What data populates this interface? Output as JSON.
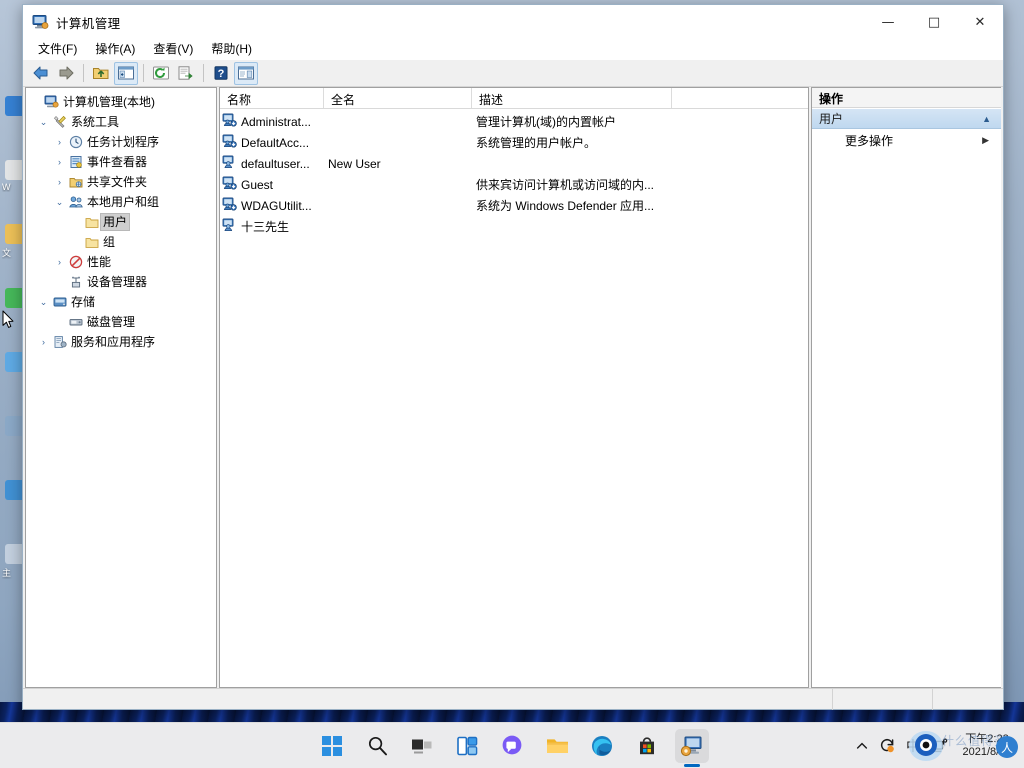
{
  "window": {
    "title": "计算机管理",
    "icon": "computer-management-icon",
    "controls": {
      "minimize": "—",
      "maximize": "□",
      "close": "✕"
    }
  },
  "menubar": [
    {
      "label": "文件(F)",
      "name": "menu-file"
    },
    {
      "label": "操作(A)",
      "name": "menu-action"
    },
    {
      "label": "查看(V)",
      "name": "menu-view"
    },
    {
      "label": "帮助(H)",
      "name": "menu-help"
    }
  ],
  "toolbar": [
    {
      "name": "back-icon",
      "title": "后退"
    },
    {
      "name": "forward-icon",
      "title": "前进"
    },
    {
      "name": "up-folder-icon",
      "title": "向上"
    },
    {
      "name": "show-hide-tree-icon",
      "title": "显示/隐藏控制台树"
    },
    {
      "name": "refresh-icon",
      "title": "刷新"
    },
    {
      "name": "export-list-icon",
      "title": "导出列表"
    },
    {
      "name": "help-icon",
      "title": "帮助"
    },
    {
      "name": "show-action-pane-icon",
      "title": "显示/隐藏操作窗格"
    }
  ],
  "tree": {
    "root": {
      "label": "计算机管理(本地)",
      "icon": "computer-icon",
      "twist": "",
      "indent": 0
    },
    "items": [
      {
        "label": "系统工具",
        "icon": "tools-icon",
        "twist": "expanded",
        "indent": 1
      },
      {
        "label": "任务计划程序",
        "icon": "clock-icon",
        "twist": "collapsed",
        "indent": 2
      },
      {
        "label": "事件查看器",
        "icon": "event-viewer-icon",
        "twist": "collapsed",
        "indent": 2
      },
      {
        "label": "共享文件夹",
        "icon": "shared-folder-icon",
        "twist": "collapsed",
        "indent": 2
      },
      {
        "label": "本地用户和组",
        "icon": "users-groups-icon",
        "twist": "expanded",
        "indent": 2
      },
      {
        "label": "用户",
        "icon": "folder-icon",
        "twist": "",
        "indent": 3,
        "selected": true
      },
      {
        "label": "组",
        "icon": "folder-icon",
        "twist": "",
        "indent": 3
      },
      {
        "label": "性能",
        "icon": "performance-icon",
        "twist": "collapsed",
        "indent": 2
      },
      {
        "label": "设备管理器",
        "icon": "device-manager-icon",
        "twist": "",
        "indent": 2
      },
      {
        "label": "存储",
        "icon": "storage-icon",
        "twist": "expanded",
        "indent": 1
      },
      {
        "label": "磁盘管理",
        "icon": "disk-management-icon",
        "twist": "",
        "indent": 2
      },
      {
        "label": "服务和应用程序",
        "icon": "services-icon",
        "twist": "collapsed",
        "indent": 1
      }
    ]
  },
  "list": {
    "columns": [
      {
        "label": "名称",
        "name": "column-name"
      },
      {
        "label": "全名",
        "name": "column-fullname"
      },
      {
        "label": "描述",
        "name": "column-description"
      }
    ],
    "rows": [
      {
        "name": "Administrat...",
        "fullname": "",
        "description": "管理计算机(域)的内置帐户",
        "icon": "user-disabled-icon"
      },
      {
        "name": "DefaultAcc...",
        "fullname": "",
        "description": "系统管理的用户帐户。",
        "icon": "user-disabled-icon"
      },
      {
        "name": "defaultuser...",
        "fullname": "New User",
        "description": "",
        "icon": "user-icon"
      },
      {
        "name": "Guest",
        "fullname": "",
        "description": "供来宾访问计算机或访问域的内...",
        "icon": "user-disabled-icon"
      },
      {
        "name": "WDAGUtilit...",
        "fullname": "",
        "description": "系统为 Windows Defender 应用...",
        "icon": "user-disabled-icon"
      },
      {
        "name": "十三先生",
        "fullname": "",
        "description": "",
        "icon": "user-icon"
      }
    ]
  },
  "actions": {
    "title": "操作",
    "group": {
      "label": "用户",
      "collapse_icon": "chevron-up-icon"
    },
    "items": [
      {
        "label": "更多操作",
        "submenu_icon": "chevron-right-icon",
        "name": "action-more-actions"
      }
    ]
  },
  "statusbar": {
    "text": ""
  },
  "taskbar": {
    "apps": [
      {
        "name": "start-button",
        "label": "开始"
      },
      {
        "name": "search-icon",
        "label": "搜索"
      },
      {
        "name": "task-view-icon",
        "label": "任务视图"
      },
      {
        "name": "widgets-icon",
        "label": "小组件"
      },
      {
        "name": "chat-icon",
        "label": "聊天"
      },
      {
        "name": "file-explorer-icon",
        "label": "文件资源管理器"
      },
      {
        "name": "edge-icon",
        "label": "Microsoft Edge"
      },
      {
        "name": "microsoft-store-icon",
        "label": "Microsoft Store"
      },
      {
        "name": "computer-management-taskbar-icon",
        "label": "计算机管理",
        "active": true
      }
    ],
    "tray": [
      {
        "name": "tray-overflow-icon",
        "glyph": "︿"
      },
      {
        "name": "tray-update-icon",
        "glyph": "↻"
      },
      {
        "name": "ime-indicator",
        "glyph": "中"
      },
      {
        "name": "network-icon",
        "glyph": "🖧"
      }
    ],
    "clock": {
      "time": "下午2:23",
      "date": "2021/8/25"
    }
  },
  "watermark": {
    "text": "什么值得买",
    "badge": "人"
  },
  "desktop_icons": [
    {
      "name": "desktop-icon-browser",
      "label": "",
      "color": "#2b7cd3"
    },
    {
      "name": "desktop-icon-word",
      "label": "W",
      "color": "#d8d8d8"
    },
    {
      "name": "desktop-icon-folder",
      "label": "文",
      "color": "#f2c14e"
    },
    {
      "name": "desktop-icon-app",
      "label": "",
      "color": "#3fb950"
    },
    {
      "name": "desktop-icon-doc",
      "label": "",
      "color": "#5aa9e6"
    },
    {
      "name": "desktop-icon-misc",
      "label": "",
      "color": "#8aa8c8"
    },
    {
      "name": "desktop-icon-blue",
      "label": "",
      "color": "#3b8fd6"
    },
    {
      "name": "desktop-icon-last",
      "label": "主",
      "color": "#c8d4e2"
    }
  ]
}
